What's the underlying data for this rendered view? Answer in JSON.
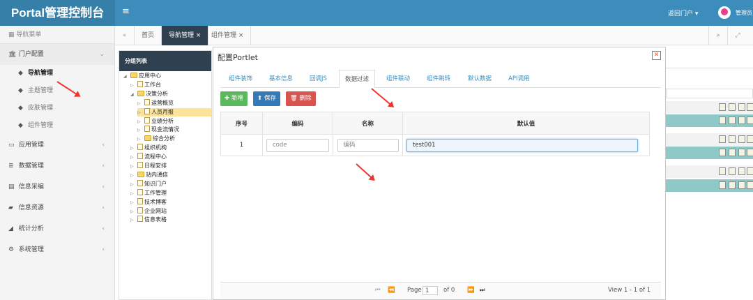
{
  "app": {
    "title": "Portal管理控制台",
    "menu_icon": "≡",
    "back_label": "返回门户 ▾",
    "admin_label": "管理员"
  },
  "sidebar": {
    "header": "导航菜单",
    "items": [
      {
        "label": "门户配置",
        "icon": "🏛",
        "arrow": "⌄"
      },
      {
        "label": "应用管理",
        "icon": "▭",
        "arrow": "‹"
      },
      {
        "label": "数据管理",
        "icon": "≣",
        "arrow": "‹"
      },
      {
        "label": "信息采编",
        "icon": "▤",
        "arrow": "‹"
      },
      {
        "label": "信息资源",
        "icon": "▰",
        "arrow": "‹"
      },
      {
        "label": "统计分析",
        "icon": "◢",
        "arrow": "‹"
      },
      {
        "label": "系统管理",
        "icon": "⚙",
        "arrow": "‹"
      }
    ],
    "sub_items": [
      {
        "label": "导航管理",
        "icon": "◆"
      },
      {
        "label": "主题管理",
        "icon": "◆"
      },
      {
        "label": "皮肤管理",
        "icon": "◆"
      },
      {
        "label": "组件管理",
        "icon": "◆"
      }
    ]
  },
  "tabs": {
    "items": [
      "首页",
      "导航管理 ×",
      "组件管理 ×"
    ],
    "prev": "«",
    "next": "»",
    "fullscreen": "⤢"
  },
  "tree": {
    "header": "分组列表",
    "nodes": [
      {
        "label": "应用中心",
        "type": "folder",
        "toggle": "◢"
      },
      {
        "label": "工作台",
        "type": "file",
        "toggle": "▷"
      },
      {
        "label": "决策分析",
        "type": "folder",
        "toggle": "◢"
      },
      {
        "label": "运营概览",
        "type": "file",
        "toggle": "▷"
      },
      {
        "label": "人员月报",
        "type": "file",
        "toggle": "▷",
        "selected": true
      },
      {
        "label": "业绩分析",
        "type": "file",
        "toggle": "▷"
      },
      {
        "label": "现金流情况",
        "type": "file",
        "toggle": "▷"
      },
      {
        "label": "综合分析",
        "type": "folder",
        "toggle": "▷"
      },
      {
        "label": "组织机构",
        "type": "file",
        "toggle": "▷"
      },
      {
        "label": "流程中心",
        "type": "file",
        "toggle": "▷"
      },
      {
        "label": "日程安排",
        "type": "file",
        "toggle": "▷"
      },
      {
        "label": "站内通信",
        "type": "folder",
        "toggle": "▷"
      },
      {
        "label": "知识门户",
        "type": "file",
        "toggle": "▷"
      },
      {
        "label": "工作管理",
        "type": "file",
        "toggle": "▷"
      },
      {
        "label": "技术博客",
        "type": "file",
        "toggle": "▷"
      },
      {
        "label": "企业网站",
        "type": "file",
        "toggle": "▷"
      },
      {
        "label": "信息表格",
        "type": "file",
        "toggle": "▷"
      }
    ]
  },
  "modal": {
    "title": "配置Portlet",
    "close": "✕",
    "tabs": [
      "组件装饰",
      "基本信息",
      "回调JS",
      "数据过滤",
      "组件联动",
      "组件跳转",
      "默认数据",
      "API调用"
    ],
    "active_tab": "数据过滤",
    "buttons": {
      "add": "✚ 新增",
      "save": "⬆ 保存",
      "del": "🗑 删除"
    },
    "columns": [
      "序号",
      "编码",
      "名称",
      "默认值"
    ],
    "rows": [
      {
        "index": "1",
        "code_placeholder": "code",
        "name_placeholder": "编码",
        "value": "test001"
      }
    ],
    "pager": {
      "first": "⏮",
      "prev": "⏪",
      "page_label": "Page",
      "page_value": "1",
      "of_label": "of 0",
      "next": "⏩",
      "last": "⏭",
      "info": "View 1 - 1 of 1"
    }
  }
}
